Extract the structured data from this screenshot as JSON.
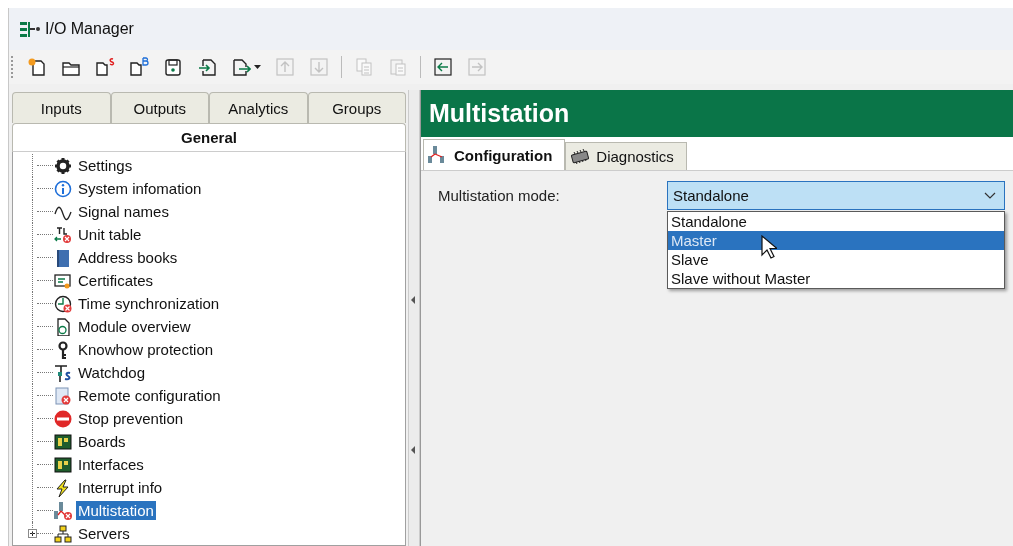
{
  "window": {
    "title": "I/O Manager"
  },
  "toolbar": [
    {
      "disabled": false
    },
    {
      "disabled": false
    },
    {
      "disabled": false
    },
    {
      "disabled": false
    },
    {
      "disabled": false
    },
    {
      "disabled": false
    },
    {
      "disabled": false,
      "kind": "menu"
    },
    {
      "disabled": true
    },
    {
      "disabled": true
    },
    {
      "disabled": true,
      "kind": "sep"
    },
    {
      "disabled": true
    },
    {
      "disabled": false,
      "kind": "sep"
    },
    {
      "disabled": true
    }
  ],
  "left_tabs": [
    {
      "label": "Inputs",
      "selected": false
    },
    {
      "label": "Outputs",
      "selected": false
    },
    {
      "label": "Analytics",
      "selected": false
    },
    {
      "label": "Groups",
      "selected": false
    },
    {
      "label": "General",
      "selected": true
    }
  ],
  "tree": [
    {
      "label": "Settings",
      "selected": false,
      "kind": "leaf"
    },
    {
      "label": "System infomation",
      "selected": false,
      "kind": "leaf"
    },
    {
      "label": "Signal names",
      "selected": false,
      "kind": "leaf"
    },
    {
      "label": "Unit table",
      "selected": false,
      "kind": "leaf"
    },
    {
      "label": "Address books",
      "selected": false,
      "kind": "leaf"
    },
    {
      "label": "Certificates",
      "selected": false,
      "kind": "leaf"
    },
    {
      "label": "Time synchronization",
      "selected": false,
      "kind": "leaf"
    },
    {
      "label": "Module overview",
      "selected": false,
      "kind": "leaf"
    },
    {
      "label": "Knowhow protection",
      "selected": false,
      "kind": "leaf"
    },
    {
      "label": "Watchdog",
      "selected": false,
      "kind": "leaf"
    },
    {
      "label": "Remote configuration",
      "selected": false,
      "kind": "leaf"
    },
    {
      "label": "Stop prevention",
      "selected": false,
      "kind": "leaf"
    },
    {
      "label": "Boards",
      "selected": false,
      "kind": "leaf"
    },
    {
      "label": "Interfaces",
      "selected": false,
      "kind": "leaf"
    },
    {
      "label": "Interrupt info",
      "selected": false,
      "kind": "leaf"
    },
    {
      "label": "Multistation",
      "selected": true,
      "kind": "leaf"
    },
    {
      "label": "Servers",
      "selected": false,
      "kind": "node",
      "expanded": false
    }
  ],
  "page": {
    "title": "Multistation",
    "tabs": [
      {
        "label": "Configuration",
        "selected": true
      },
      {
        "label": "Diagnostics",
        "selected": false
      }
    ],
    "field": {
      "label": "Multistation mode:",
      "value": "Standalone",
      "open": true,
      "options": [
        {
          "label": "Standalone",
          "highlighted": false
        },
        {
          "label": "Master",
          "highlighted": true
        },
        {
          "label": "Slave",
          "highlighted": false
        },
        {
          "label": "Slave without Master",
          "highlighted": false
        }
      ]
    }
  }
}
